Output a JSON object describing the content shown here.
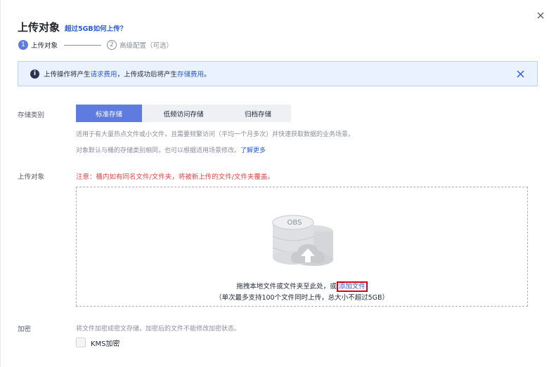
{
  "dialog": {
    "title": "上传对象",
    "title_link": "超过5GB如何上传？",
    "close_icon": "close-icon"
  },
  "steps": [
    {
      "number": "1",
      "label": "上传对象",
      "state": "active"
    },
    {
      "number": "2",
      "label": "高级配置（可选）",
      "state": "inactive"
    }
  ],
  "alert": {
    "text_before": "上传操作将产生",
    "link1": "请求费用",
    "text_middle": "，上传成功后将产生",
    "link2": "存储费用",
    "text_after": "。",
    "icon": "info-icon"
  },
  "storage_class": {
    "label": "存储类别",
    "options": [
      "标准存储",
      "低频访问存储",
      "归档存储"
    ],
    "selected": "标准存储",
    "hint1": "适用于有大量热点文件或小文件，且需要频繁访问（平均一个月多次）并快速获取数据的业务场景。",
    "hint2_text": "对象默认与桶的存储类别相同，也可以根据适用场景修改。",
    "hint2_link": "了解更多"
  },
  "upload": {
    "label": "上传对象",
    "warning": "注意：桶内如有同名文件/文件夹，将被新上传的文件/文件夹覆盖。",
    "obs_text": "OBS",
    "drop_text": "拖拽本地文件或文件夹至此处，或",
    "drop_link": "添加文件",
    "drop_subtext": "（单次最多支持100个文件同时上传，总大小不超过5GB）"
  },
  "encryption": {
    "label": "加密",
    "hint": "将文件加密成密文存储，加密后的文件不能修改加密状态。",
    "checkbox_label": "KMS加密",
    "checked": false
  },
  "colors": {
    "accent": "#5e7ce0",
    "link": "#2a5bd7",
    "warning": "#e54545",
    "alert_bg": "#eaf2ff"
  }
}
